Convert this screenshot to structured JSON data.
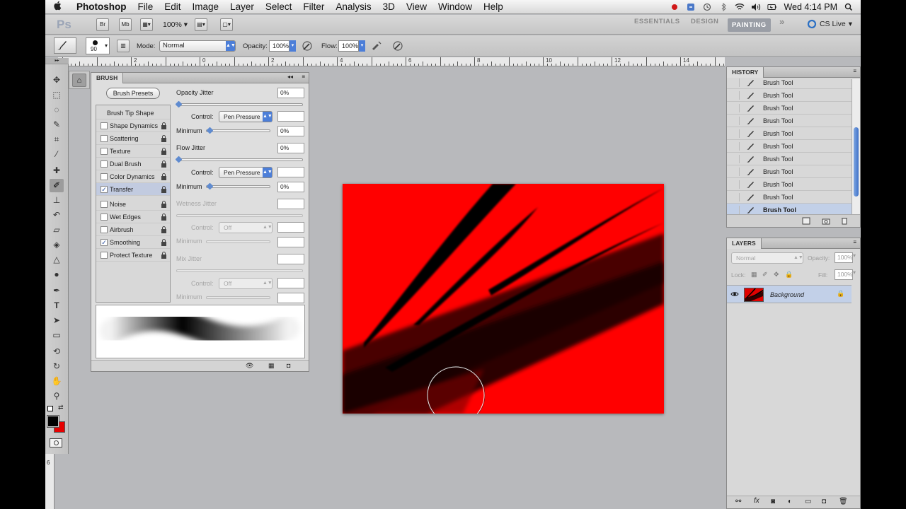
{
  "menubar": {
    "app_name": "Photoshop",
    "items": [
      "File",
      "Edit",
      "Image",
      "Layer",
      "Select",
      "Filter",
      "Analysis",
      "3D",
      "View",
      "Window",
      "Help"
    ],
    "clock": "Wed 4:14 PM"
  },
  "appbar": {
    "logo": "Ps",
    "bridge": "Br",
    "minibridge": "Mb",
    "zoom": "100%",
    "workspaces": [
      "ESSENTIALS",
      "DESIGN",
      "PAINTING"
    ],
    "active_workspace": "PAINTING",
    "more": "»",
    "cs_live": "CS Live"
  },
  "options": {
    "brush_size": "90",
    "mode_label": "Mode:",
    "mode_value": "Normal",
    "opacity_label": "Opacity:",
    "opacity_value": "100%",
    "flow_label": "Flow:",
    "flow_value": "100%"
  },
  "ruler": {
    "labels": [
      "4",
      "2",
      "0",
      "2",
      "4",
      "6",
      "8",
      "10",
      "12",
      "14"
    ]
  },
  "brush_panel": {
    "tab": "BRUSH",
    "presets_button": "Brush Presets",
    "options": [
      {
        "label": "Brush Tip Shape",
        "checkbox": false,
        "title": true
      },
      {
        "label": "Shape Dynamics",
        "checkbox": true,
        "checked": false
      },
      {
        "label": "Scattering",
        "checkbox": true,
        "checked": false
      },
      {
        "label": "Texture",
        "checkbox": true,
        "checked": false
      },
      {
        "label": "Dual Brush",
        "checkbox": true,
        "checked": false
      },
      {
        "label": "Color Dynamics",
        "checkbox": true,
        "checked": false
      },
      {
        "label": "Transfer",
        "checkbox": true,
        "checked": true,
        "active": true
      },
      {
        "label": "Noise",
        "checkbox": true,
        "checked": false
      },
      {
        "label": "Wet Edges",
        "checkbox": true,
        "checked": false
      },
      {
        "label": "Airbrush",
        "checkbox": true,
        "checked": false
      },
      {
        "label": "Smoothing",
        "checkbox": true,
        "checked": true
      },
      {
        "label": "Protect Texture",
        "checkbox": true,
        "checked": false
      }
    ],
    "opacity_jitter_label": "Opacity Jitter",
    "opacity_jitter_value": "0%",
    "control_label": "Control:",
    "control_value": "Pen Pressure",
    "minimum_label": "Minimum",
    "minimum_value": "0%",
    "flow_jitter_label": "Flow Jitter",
    "flow_jitter_value": "0%",
    "control2_value": "Pen Pressure",
    "minimum2_value": "0%",
    "wetness_jitter_label": "Wetness Jitter",
    "control3_value": "Off",
    "mix_jitter_label": "Mix Jitter",
    "control4_value": "Off"
  },
  "history": {
    "title": "HISTORY",
    "items": [
      "Brush Tool",
      "Brush Tool",
      "Brush Tool",
      "Brush Tool",
      "Brush Tool",
      "Brush Tool",
      "Brush Tool",
      "Brush Tool",
      "Brush Tool",
      "Brush Tool",
      "Brush Tool"
    ]
  },
  "layers": {
    "title": "LAYERS",
    "blend_mode": "Normal",
    "opacity_label": "Opacity:",
    "opacity_value": "100%",
    "lock_label": "Lock:",
    "fill_label": "Fill:",
    "fill_value": "100%",
    "layer_name": "Background"
  },
  "colors": {
    "canvas_red": "#ff0000",
    "foreground": "#000000",
    "background": "#e60000",
    "selection": "#c2d0e8"
  }
}
